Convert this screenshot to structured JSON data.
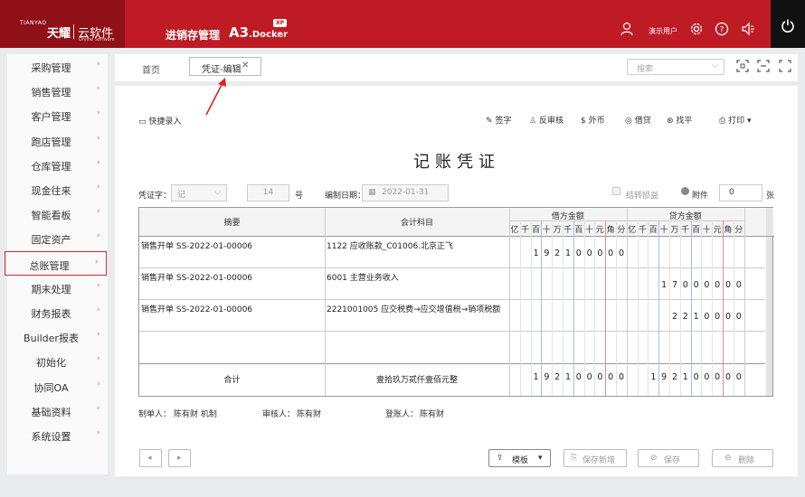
{
  "header": {
    "logo_en": "TIANYAO",
    "logo_cn": "天耀",
    "logo_cloud": "云软件",
    "logo_sub": "Online Software",
    "product": "进销存管理",
    "a3": "A3",
    "a3_sub": ".Docker",
    "badge": "XP",
    "user": "演示用户"
  },
  "sidebar": {
    "items": [
      {
        "label": "采购管理"
      },
      {
        "label": "销售管理"
      },
      {
        "label": "客户管理"
      },
      {
        "label": "跑店管理"
      },
      {
        "label": "仓库管理"
      },
      {
        "label": "现金往来"
      },
      {
        "label": "智能看板"
      },
      {
        "label": "固定资产"
      },
      {
        "label": "总账管理",
        "active": true
      },
      {
        "label": "期末处理"
      },
      {
        "label": "财务报表"
      },
      {
        "label": "Builder报表"
      },
      {
        "label": "初始化"
      },
      {
        "label": "协同OA"
      },
      {
        "label": "基础资料"
      },
      {
        "label": "系统设置"
      }
    ]
  },
  "tabs": {
    "home": "首页",
    "active": "凭证-编辑",
    "search_placeholder": "搜索"
  },
  "toolbar": {
    "quick_entry": "快捷录入",
    "sign": "签字",
    "unaudit": "反审核",
    "foreign": "外币",
    "borrow": "借贷",
    "balance": "找平",
    "print": "打印"
  },
  "voucher": {
    "title": "记账凭证",
    "word_label": "凭证字：",
    "word_value": "记",
    "number": "14",
    "number_suffix": "号",
    "date_label": "编制日期：",
    "date_value": "2022-01-31",
    "carry_label": "结转损益",
    "attach_label": "附件",
    "attach_value": "0",
    "attach_unit": "张"
  },
  "table": {
    "col_summary": "摘要",
    "col_account": "会计科目",
    "col_debit": "借方金额",
    "col_credit": "贷方金额",
    "units": [
      "亿",
      "千",
      "百",
      "十",
      "万",
      "千",
      "百",
      "十",
      "元",
      "角",
      "分"
    ],
    "rows": [
      {
        "summary": "销售开单 SS-2022-01-00006",
        "account": "1122 应收账款_C01006.北京正飞",
        "debit": "192100000",
        "credit": ""
      },
      {
        "summary": "销售开单 SS-2022-01-00006",
        "account": "6001 主营业务收入",
        "debit": "",
        "credit": "17000000"
      },
      {
        "summary": "销售开单 SS-2022-01-00006",
        "account": "2221001005 应交税费→应交增值税→销项税额",
        "debit": "",
        "credit": "2210000"
      },
      {
        "summary": "",
        "account": "",
        "debit": "",
        "credit": ""
      }
    ],
    "total_label": "合计",
    "total_words": "壹拾玖万贰仟壹佰元整",
    "total_debit": "192100000",
    "total_credit": "192100000"
  },
  "signatures": {
    "maker_label": "制单人：",
    "maker": "陈有财 机制",
    "auditor_label": "审核人：",
    "auditor": "陈有财",
    "poster_label": "登账人：",
    "poster": "陈有财"
  },
  "bottom": {
    "template": "模板",
    "save_new": "保存新增",
    "save": "保存",
    "delete": "删除"
  },
  "colors": {
    "brand_red": "#bf1b24",
    "dark_red": "#8f1117",
    "annotation_red": "#d9262d"
  }
}
